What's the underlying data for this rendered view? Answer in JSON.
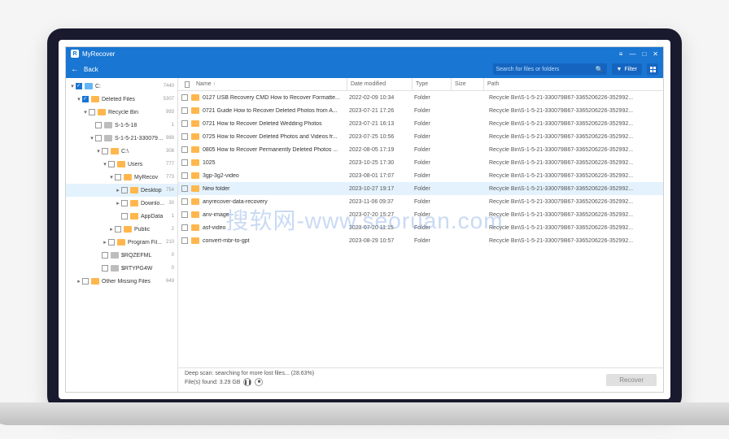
{
  "app": {
    "title": "MyRecover",
    "back": "Back"
  },
  "search": {
    "placeholder": "Search for files or folders"
  },
  "filter": {
    "label": "Filter"
  },
  "watermark": "搜软网-www.seoruan.com",
  "tree": [
    {
      "indent": 0,
      "chev": "▾",
      "checked": true,
      "icon": "drive",
      "label": "C:",
      "count": "7440"
    },
    {
      "indent": 1,
      "chev": "▾",
      "checked": true,
      "icon": "folder",
      "label": "Deleted Files",
      "count": "5307"
    },
    {
      "indent": 2,
      "chev": "▾",
      "checked": false,
      "icon": "folder",
      "label": "Recycle Bin",
      "count": "993"
    },
    {
      "indent": 3,
      "chev": "",
      "checked": false,
      "icon": "folder-grey",
      "label": "S-1-5-18",
      "count": "1"
    },
    {
      "indent": 3,
      "chev": "▾",
      "checked": false,
      "icon": "folder-grey",
      "label": "S-1-5-21-330079B...",
      "count": "989"
    },
    {
      "indent": 4,
      "chev": "▾",
      "checked": false,
      "icon": "folder",
      "label": "C:\\",
      "count": "308"
    },
    {
      "indent": 5,
      "chev": "▾",
      "checked": false,
      "icon": "folder",
      "label": "Users",
      "count": "777"
    },
    {
      "indent": 6,
      "chev": "▾",
      "checked": false,
      "icon": "folder",
      "label": "MyRecov",
      "count": "773"
    },
    {
      "indent": 7,
      "chev": "▸",
      "checked": false,
      "icon": "folder",
      "label": "Desktop",
      "count": "754",
      "sel": true
    },
    {
      "indent": 7,
      "chev": "▸",
      "checked": false,
      "icon": "folder",
      "label": "Downlo...",
      "count": "30"
    },
    {
      "indent": 7,
      "chev": "",
      "checked": false,
      "icon": "folder",
      "label": "AppData",
      "count": "1"
    },
    {
      "indent": 6,
      "chev": "▸",
      "checked": false,
      "icon": "folder",
      "label": "Public",
      "count": "2"
    },
    {
      "indent": 5,
      "chev": "▸",
      "checked": false,
      "icon": "folder",
      "label": "Program Fil...",
      "count": "210"
    },
    {
      "indent": 4,
      "chev": "",
      "checked": false,
      "icon": "folder-grey",
      "label": "$RQZEFML",
      "count": "0"
    },
    {
      "indent": 4,
      "chev": "",
      "checked": false,
      "icon": "folder-grey",
      "label": "$RTYPG4W",
      "count": "0"
    },
    {
      "indent": 1,
      "chev": "▸",
      "checked": false,
      "icon": "folder",
      "label": "Other Missing Files",
      "count": "649"
    }
  ],
  "columns": {
    "name": "Name",
    "date": "Date modified",
    "type": "Type",
    "size": "Size",
    "path": "Path"
  },
  "rows": [
    {
      "name": "0127 USB Recovery CMD How to Recover Formatte...",
      "date": "2022-02-09 10:34",
      "type": "Folder",
      "path": "Recycle Bin\\S-1-5-21-330079B67-3365206226-352992..."
    },
    {
      "name": "0721 Guide How to Recover Deleted Photos from A...",
      "date": "2023-07-21 17:26",
      "type": "Folder",
      "path": "Recycle Bin\\S-1-5-21-330079B67-3365206226-352992..."
    },
    {
      "name": "0721 How to Recover Deleted Wedding Photos",
      "date": "2023-07-21 16:13",
      "type": "Folder",
      "path": "Recycle Bin\\S-1-5-21-330079B67-3365206226-352992..."
    },
    {
      "name": "0725 How to Recover Deleted Photos and Videos fr...",
      "date": "2023-07-25 10:56",
      "type": "Folder",
      "path": "Recycle Bin\\S-1-5-21-330079B67-3365206226-352992..."
    },
    {
      "name": "0805 How to Recover Permanently Deleted Photos ...",
      "date": "2022-08-05 17:19",
      "type": "Folder",
      "path": "Recycle Bin\\S-1-5-21-330079B67-3365206226-352992..."
    },
    {
      "name": "1025",
      "date": "2023-10-25 17:30",
      "type": "Folder",
      "path": "Recycle Bin\\S-1-5-21-330079B67-3365206226-352992..."
    },
    {
      "name": "3gp-3g2-video",
      "date": "2023-08-01 17:07",
      "type": "Folder",
      "path": "Recycle Bin\\S-1-5-21-330079B67-3365206226-352992..."
    },
    {
      "name": "New folder",
      "date": "2023-10-27 19:17",
      "type": "Folder",
      "path": "Recycle Bin\\S-1-5-21-330079B67-3365206226-352992...",
      "sel": true
    },
    {
      "name": "anyrecover-data-recovery",
      "date": "2023-11-06 09:37",
      "type": "Folder",
      "path": "Recycle Bin\\S-1-5-21-330079B67-3365206226-352992..."
    },
    {
      "name": "anv-image",
      "date": "2023-07-20 15:27",
      "type": "Folder",
      "path": "Recycle Bin\\S-1-5-21-330079B67-3365206226-352992..."
    },
    {
      "name": "asf-video",
      "date": "2023-07-20 11:15",
      "type": "Folder",
      "path": "Recycle Bin\\S-1-5-21-330079B67-3365206226-352992..."
    },
    {
      "name": "convert-mbr-to-gpt",
      "date": "2023-08-29 10:57",
      "type": "Folder",
      "path": "Recycle Bin\\S-1-5-21-330079B67-3365206226-352992..."
    }
  ],
  "footer": {
    "scan": "Deep scan: searching for more lost files... (28.63%)",
    "found": "File(s) found: 3.29 GB",
    "recover": "Recover"
  }
}
